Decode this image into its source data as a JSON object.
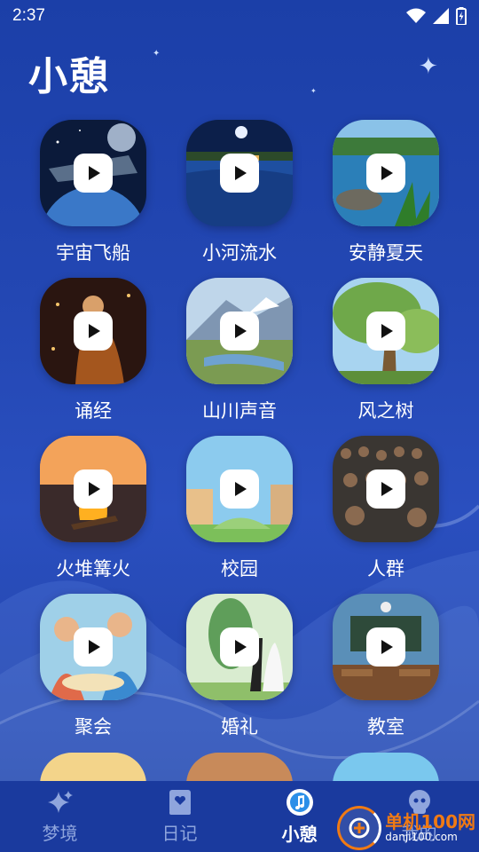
{
  "status": {
    "time": "2:37"
  },
  "title": "小憩",
  "items": [
    {
      "label": "宇宙飞船",
      "art": "space"
    },
    {
      "label": "小河流水",
      "art": "river"
    },
    {
      "label": "安静夏天",
      "art": "summer"
    },
    {
      "label": "诵经",
      "art": "monk"
    },
    {
      "label": "山川声音",
      "art": "mountain"
    },
    {
      "label": "风之树",
      "art": "tree"
    },
    {
      "label": "火堆篝火",
      "art": "fire"
    },
    {
      "label": "校园",
      "art": "campus"
    },
    {
      "label": "人群",
      "art": "crowd"
    },
    {
      "label": "聚会",
      "art": "party"
    },
    {
      "label": "婚礼",
      "art": "wedding"
    },
    {
      "label": "教室",
      "art": "classroom"
    }
  ],
  "tabs": [
    {
      "label": "梦境",
      "icon": "sparkle-icon",
      "active": false
    },
    {
      "label": "日记",
      "icon": "diary-icon",
      "active": false
    },
    {
      "label": "小憩",
      "icon": "music-note-icon",
      "active": true
    },
    {
      "label": "我的",
      "icon": "profile-icon",
      "active": false
    }
  ],
  "watermark": {
    "name": "单机100网",
    "url": "danji100.com"
  },
  "colors": {
    "background": "#2347b3",
    "tabbar": "#1a3a9e",
    "active_tab": "#ffffff",
    "inactive_tab": "#8fa5dd"
  }
}
